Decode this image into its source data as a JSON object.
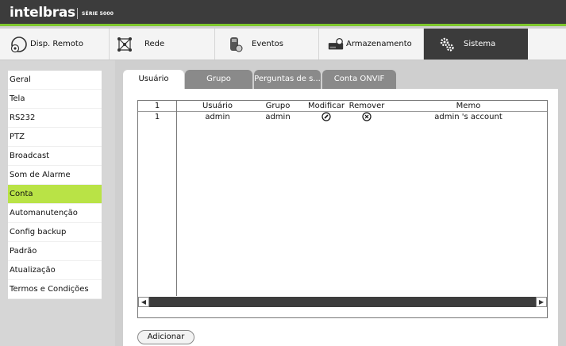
{
  "header": {
    "brand": "intelbras",
    "series": "SÉRIE 5000"
  },
  "nav": {
    "items": [
      {
        "label": "Disp. Remoto",
        "icon": "remote-device-icon"
      },
      {
        "label": "Rede",
        "icon": "network-icon"
      },
      {
        "label": "Eventos",
        "icon": "events-icon"
      },
      {
        "label": "Armazenamento",
        "icon": "storage-icon"
      },
      {
        "label": "Sistema",
        "icon": "gears-icon"
      }
    ],
    "active": "Sistema"
  },
  "sidebar": {
    "items": [
      {
        "label": "Geral"
      },
      {
        "label": "Tela"
      },
      {
        "label": "RS232"
      },
      {
        "label": "PTZ"
      },
      {
        "label": "Broadcast"
      },
      {
        "label": "Som de Alarme"
      },
      {
        "label": "Conta"
      },
      {
        "label": "Automanutenção"
      },
      {
        "label": "Config backup"
      },
      {
        "label": "Padrão"
      },
      {
        "label": "Atualização"
      },
      {
        "label": "Termos e Condições"
      }
    ],
    "active": "Conta"
  },
  "tabs": [
    {
      "label": "Usuário"
    },
    {
      "label": "Grupo"
    },
    {
      "label": "Perguntas de s..."
    },
    {
      "label": "Conta ONVIF"
    }
  ],
  "table": {
    "headers": {
      "num": "1",
      "user": "Usuário",
      "group": "Grupo",
      "modify": "Modificar",
      "remove": "Remover",
      "memo": "Memo"
    },
    "rows": [
      {
        "num": "1",
        "user": "admin",
        "group": "admin",
        "memo": "admin 's account"
      }
    ]
  },
  "add_label": "Adicionar",
  "colors": {
    "accent": "#b9e346",
    "header_bg": "#3c3c3c",
    "tab_inactive": "#8a8a8a"
  }
}
